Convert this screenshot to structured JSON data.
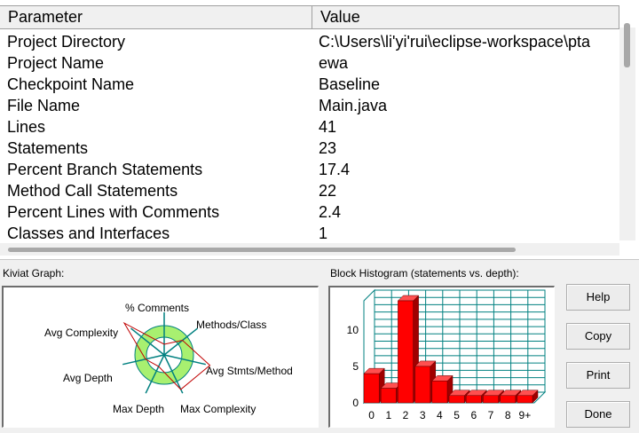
{
  "table": {
    "columns": [
      "Parameter",
      "Value"
    ],
    "rows": [
      {
        "parameter": "Project Directory",
        "value": "C:\\Users\\li'yi'rui\\eclipse-workspace\\pta"
      },
      {
        "parameter": "Project Name",
        "value": "ewa"
      },
      {
        "parameter": "Checkpoint Name",
        "value": "Baseline"
      },
      {
        "parameter": "File Name",
        "value": "Main.java"
      },
      {
        "parameter": "Lines",
        "value": "41"
      },
      {
        "parameter": "Statements",
        "value": "23"
      },
      {
        "parameter": "Percent Branch Statements",
        "value": "17.4"
      },
      {
        "parameter": "Method Call Statements",
        "value": "22"
      },
      {
        "parameter": "Percent Lines with Comments",
        "value": "2.4"
      },
      {
        "parameter": "Classes and Interfaces",
        "value": "1"
      }
    ]
  },
  "kiviat": {
    "label": "Kiviat Graph:",
    "axes": [
      "% Comments",
      "Methods/Class",
      "Avg Stmts/Method",
      "Max Complexity",
      "Max Depth",
      "Avg Depth",
      "Avg Complexity"
    ]
  },
  "histogram": {
    "label": "Block Histogram (statements vs. depth):",
    "y_ticks": [
      "0",
      "5",
      "10"
    ]
  },
  "chart_data": {
    "type": "bar",
    "title": "Block Histogram (statements vs. depth):",
    "categories": [
      "0",
      "1",
      "2",
      "3",
      "4",
      "5",
      "6",
      "7",
      "8",
      "9+"
    ],
    "values": [
      4,
      2,
      14,
      5,
      3,
      1,
      1,
      1,
      1,
      1
    ],
    "ylim": [
      0,
      14
    ],
    "yticks": [
      0,
      5,
      10
    ],
    "grid": true,
    "bar_color": "#ff0000"
  },
  "buttons": {
    "help": "Help",
    "copy": "Copy",
    "print": "Print",
    "done": "Done"
  },
  "colors": {
    "kiviat_ring": "#a8f070",
    "kiviat_outline": "#008080",
    "kiviat_data": "#c00000",
    "hist_grid": "#008080",
    "hist_bar": "#ff0000"
  }
}
